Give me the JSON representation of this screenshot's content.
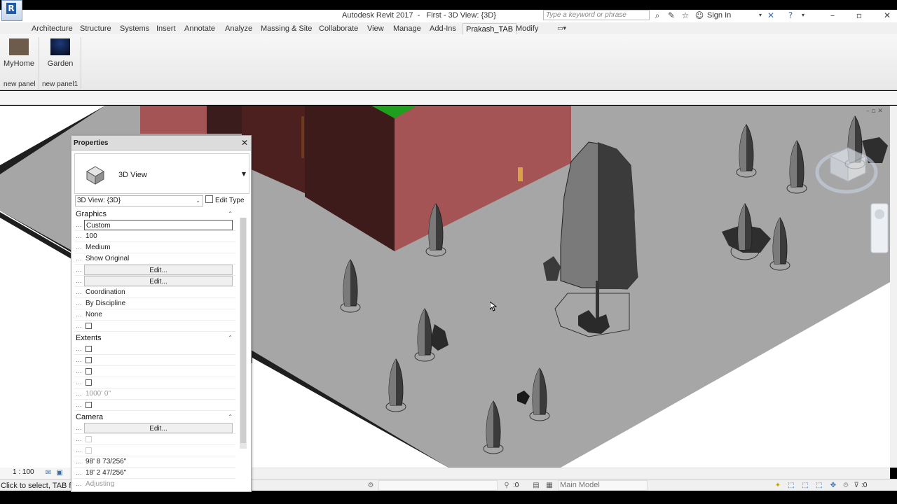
{
  "window": {
    "app_name": "Autodesk Revit 2017",
    "title": "Autodesk Revit 2017  -   First - 3D View: {3D}",
    "search_placeholder": "Type a keyword or phrase",
    "sign_in": "Sign In"
  },
  "tabs": [
    {
      "label": "Architecture"
    },
    {
      "label": "Structure"
    },
    {
      "label": "Systems"
    },
    {
      "label": "Insert"
    },
    {
      "label": "Annotate"
    },
    {
      "label": "Analyze"
    },
    {
      "label": "Massing & Site"
    },
    {
      "label": "Collaborate"
    },
    {
      "label": "View"
    },
    {
      "label": "Manage"
    },
    {
      "label": "Add-Ins"
    },
    {
      "label": "Prakash_TAB",
      "active": true
    },
    {
      "label": "Modify"
    }
  ],
  "ribbon": {
    "buttons": [
      {
        "label": "MyHome",
        "color": "#6d5b4c"
      },
      {
        "label": "Garden",
        "color": "#0b1530"
      }
    ],
    "panels": [
      {
        "label": "new panel"
      },
      {
        "label": "new panel1"
      }
    ]
  },
  "properties": {
    "title": "Properties",
    "type_name": "3D View",
    "instance_filter": "3D View: {3D}",
    "edit_type": "Edit Type",
    "sections": {
      "graphics": "Graphics",
      "extents": "Extents",
      "camera": "Camera"
    },
    "graphics_values": {
      "view_scale": "Custom",
      "scale_value": "100",
      "detail_level": "Medium",
      "parts_visibility": "Show Original",
      "vg_overrides": "Edit...",
      "graphic_display": "Edit...",
      "discipline": "Coordination",
      "show_hidden_lines": "By Discipline",
      "default_analysis": "None"
    },
    "extents_values": {
      "far_clip_offset": "1000'  0\""
    },
    "camera_values": {
      "rendering_settings": "Edit...",
      "eye_elevation": "98'  8 73/256\"",
      "target_elevation": "18'  2 47/256\"",
      "camera_position": "Adjusting"
    }
  },
  "view": {
    "scale": "1 : 100"
  },
  "status": {
    "hint": "Click to select, TAB for",
    "selection_count": ":0",
    "design_option": "Main Model",
    "filter_count": ":0"
  },
  "colors": {
    "wall_red": "#a45454",
    "wall_dark": "#3b1c1c",
    "ground": "#a6a6a6",
    "roof_green": "#1ea01e"
  },
  "icons": [
    "home-3d-icon",
    "close-icon",
    "search-icon",
    "star-icon",
    "user-icon",
    "help-icon",
    "view-cube-icon"
  ]
}
